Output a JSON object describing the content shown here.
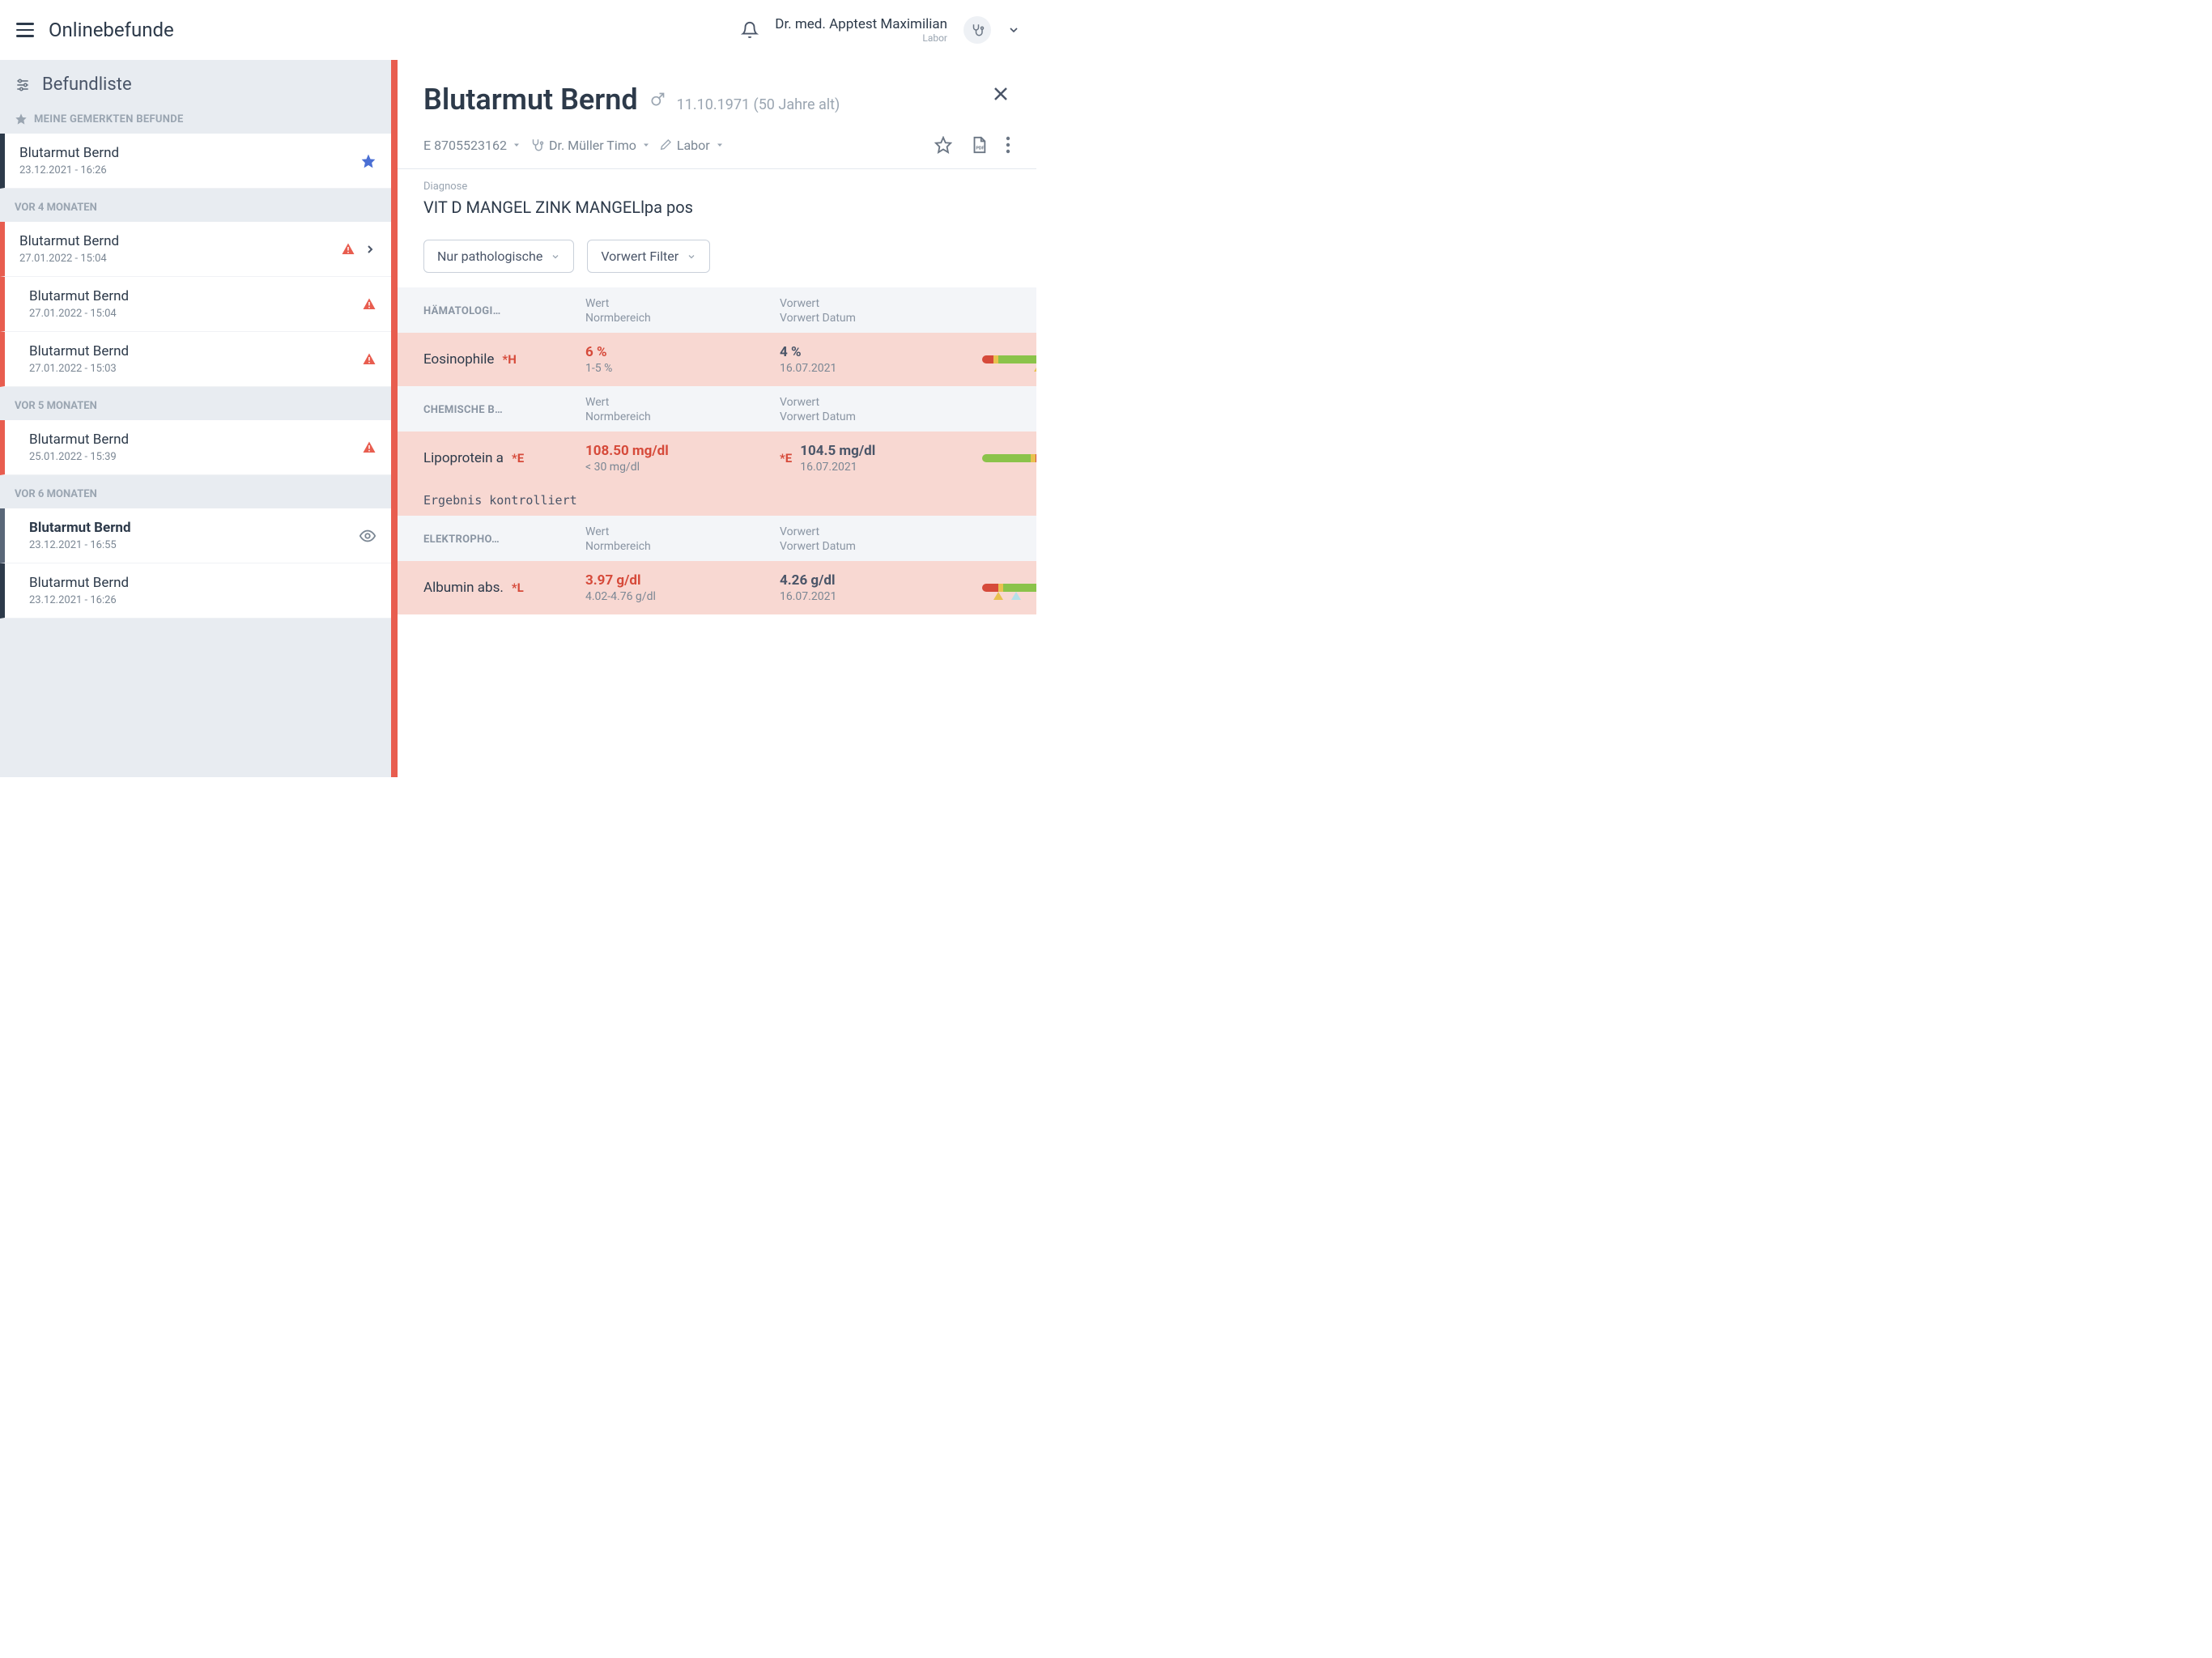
{
  "header": {
    "title": "Onlinebefunde",
    "user_name": "Dr. med. Apptest Maximilian",
    "user_sub": "Labor"
  },
  "sidebar": {
    "title": "Befundliste",
    "bookmarked_label": "MEINE GEMERKTEN BEFUNDE",
    "sections": [
      {
        "label": "VOR 4 MONATEN"
      },
      {
        "label": "VOR 5 MONATEN"
      },
      {
        "label": "VOR 6 MONATEN"
      }
    ],
    "items": {
      "bookmarked": {
        "name": "Blutarmut Bernd",
        "date": "23.12.2021 - 16:26"
      },
      "s0": [
        {
          "name": "Blutarmut Bernd",
          "date": "27.01.2022 - 15:04"
        },
        {
          "name": "Blutarmut Bernd",
          "date": "27.01.2022 - 15:04"
        },
        {
          "name": "Blutarmut Bernd",
          "date": "27.01.2022 - 15:03"
        }
      ],
      "s1": [
        {
          "name": "Blutarmut Bernd",
          "date": "25.01.2022 - 15:39"
        }
      ],
      "s2": [
        {
          "name": "Blutarmut Bernd",
          "date": "23.12.2021 - 16:55"
        },
        {
          "name": "Blutarmut Bernd",
          "date": "23.12.2021 - 16:26"
        }
      ]
    }
  },
  "detail": {
    "patient_name": "Blutarmut Bernd",
    "dob": "11.10.1971 (50 Jahre alt)",
    "meta": {
      "order_id": "E 8705523162",
      "doctor": "Dr. Müller Timo",
      "dept": "Labor"
    },
    "diagnosis_label": "Diagnose",
    "diagnosis_text": "VIT D MANGEL ZINK MANGELlpa pos",
    "filters": {
      "pathological": "Nur pathologische",
      "vorwert": "Vorwert Filter"
    },
    "col": {
      "wert": "Wert",
      "norm": "Normbereich",
      "vorwert": "Vorwert",
      "vorwert_datum": "Vorwert Datum"
    },
    "categories": {
      "haem": "HÄMATOLOGI…",
      "chem": "CHEMISCHE B…",
      "elek": "ELEKTROPHO…"
    },
    "results": {
      "eosino": {
        "name": "Eosinophile",
        "flag": "*H",
        "value": "6 %",
        "norm": "1-5 %",
        "prev": "4 %",
        "prev_date": "16.07.2021"
      },
      "lipo": {
        "name": "Lipoprotein a",
        "flag": "*E",
        "value": "108.50 mg/dl",
        "norm": "< 30 mg/dl",
        "prev_flag": "*E",
        "prev": "104.5 mg/dl",
        "prev_date": "16.07.2021",
        "note": "Ergebnis kontrolliert"
      },
      "albumin": {
        "name": "Albumin abs.",
        "flag": "*L",
        "value": "3.97 g/dl",
        "norm": "4.02-4.76 g/dl",
        "prev": "4.26 g/dl",
        "prev_date": "16.07.2021"
      }
    }
  }
}
